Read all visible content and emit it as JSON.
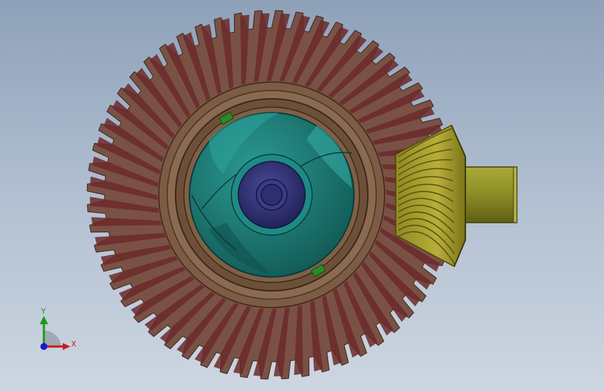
{
  "viewport": {
    "background_top": "#8ea1b9",
    "background_bottom": "#cdd6e1"
  },
  "model": {
    "ring_gear": {
      "teeth": 56,
      "tooth_color": "#7a5245",
      "flank_color": "#6b2a2a",
      "body_color": "#8a6a50"
    },
    "differential_housing": {
      "color": "#1f7d78"
    },
    "hub": {
      "color": "#3a3a80"
    },
    "pinion_gear": {
      "teeth": 14,
      "color": "#a8a030",
      "groove_color": "#5a5412"
    },
    "shaft": {
      "color": "#8c8c26"
    },
    "keys": {
      "color": "#2a8a2a"
    }
  },
  "triad": {
    "x_label": "X",
    "y_label": "Y",
    "x_color": "#cc1a1a",
    "y_color": "#1a9a1a",
    "z_color": "#1a1acc"
  }
}
